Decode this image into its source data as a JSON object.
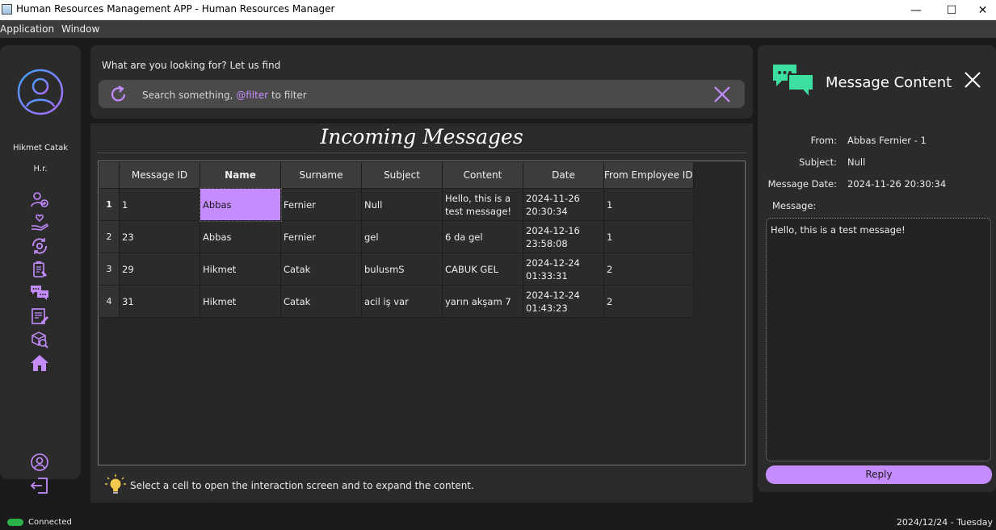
{
  "window": {
    "title": "Human Resources Management APP - Human Resources Manager",
    "minimize": "—",
    "maximize": "☐",
    "close": "✕"
  },
  "menu": [
    "Application",
    "Window"
  ],
  "user": {
    "name": "Hikmet Catak",
    "role": "H.r."
  },
  "nav_icons": [
    "add-employee-icon",
    "hand-heart-icon",
    "sync-settings-icon",
    "clipboard-icon",
    "messages-icon",
    "edit-document-icon",
    "package-search-icon",
    "home-icon",
    "profile-icon",
    "logout-icon"
  ],
  "search": {
    "prompt": "What are you looking for? Let us find",
    "placeholder_a": "Search something, ",
    "placeholder_filter": "@filter",
    "placeholder_b": " to filter"
  },
  "main": {
    "heading": "Incoming Messages",
    "columns": [
      "Message ID",
      "Name",
      "Surname",
      "Subject",
      "Content",
      "Date",
      "From Employee ID"
    ],
    "rows": [
      {
        "n": "1",
        "id": "1",
        "name": "Abbas",
        "surname": "Fernier",
        "subject": "Null",
        "content": "Hello, this is a test message!",
        "date": "2024-11-26 20:30:34",
        "from": "1"
      },
      {
        "n": "2",
        "id": "23",
        "name": "Abbas",
        "surname": "Fernier",
        "subject": "gel",
        "content": "6 da gel",
        "date": "2024-12-16 23:58:08",
        "from": "1"
      },
      {
        "n": "3",
        "id": "29",
        "name": "Hikmet",
        "surname": "Catak",
        "subject": "bulusmS",
        "content": "CABUK GEL",
        "date": "2024-12-24 01:33:31",
        "from": "2"
      },
      {
        "n": "4",
        "id": "31",
        "name": "Hikmet",
        "surname": "Catak",
        "subject": "acil iş var",
        "content": "yarın akşam 7",
        "date": "2024-12-24 01:43:23",
        "from": "2"
      }
    ],
    "hint": "Select a cell to open the interaction screen and to expand the content."
  },
  "detail": {
    "title": "Message Content",
    "from_label": "From:",
    "from_value": "Abbas Fernier - 1",
    "subject_label": "Subject:",
    "subject_value": "Null",
    "date_label": "Message Date:",
    "date_value": "2024-11-26 20:30:34",
    "message_label": "Message:",
    "message_value": "Hello, this is a test message!",
    "reply": "Reply"
  },
  "status": {
    "connection": "Connected",
    "date": "2024/12/24 - Tuesday"
  },
  "colors": {
    "accent": "#c58cff",
    "icon_green": "#3de0a0",
    "connected": "#2bb14a"
  }
}
